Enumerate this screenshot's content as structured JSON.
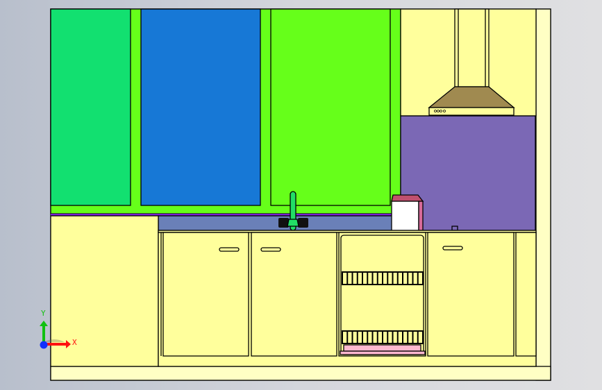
{
  "viewport": {
    "triad": {
      "x_label": "X",
      "y_label": "Y",
      "x_color": "#ff1010",
      "y_color": "#10c010",
      "z_color": "#1030ff"
    }
  },
  "colors": {
    "wall": "#ffff9c",
    "wall_light": "#ffffc4",
    "upper_cabinet_left": "#12e070",
    "upper_cabinet_middle": "#1778d6",
    "upper_cabinet_right": "#66ff1a",
    "backsplash_stove": "#7b68b5",
    "backsplash_sink": "#6a80b8",
    "hood": "#a08a50",
    "dish_rack_tray": "#ffb8d0",
    "faucet": "#22dd66"
  }
}
